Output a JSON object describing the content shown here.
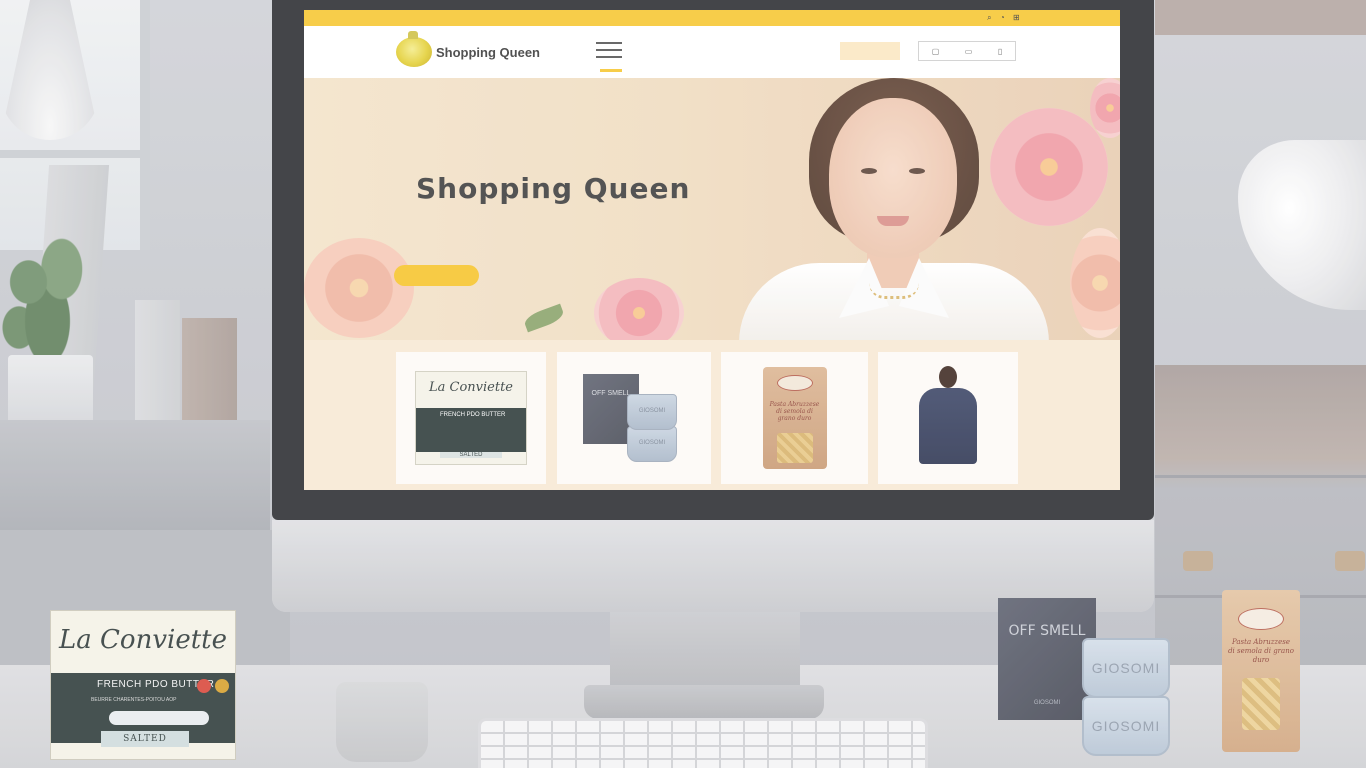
{
  "site": {
    "brand": "Shopping Queen",
    "top_strip_text": "",
    "nav_links": [
      "",
      "",
      ""
    ],
    "nav_button_label": "",
    "nav_sub_text": "",
    "nav_sub_right": ""
  },
  "hero": {
    "title": "Shopping Queen",
    "cta_label": ""
  },
  "product_cards": [
    {
      "name": "la-conviette-butter",
      "brand": "La Conviette",
      "label": "FRENCH PDO BUTTER",
      "variant": "SALTED"
    },
    {
      "name": "off-smell-cups",
      "box_text": "OFF SMELL",
      "cup_text": "GIOSOMI"
    },
    {
      "name": "pasta-bag",
      "text": "Pasta Abruzzese di semola di grano duro"
    },
    {
      "name": "cardigan-model",
      "text": ""
    }
  ],
  "desk_products": {
    "butter": {
      "brand": "La Conviette",
      "title": "FRENCH PDO BUTTER",
      "subtitle": "BEURRE CHARENTES-POITOU AOP",
      "variant": "SALTED"
    },
    "box": {
      "title": "OFF SMELL",
      "bottom": "GIOSOMI"
    },
    "cup_top": "GIOSOMI",
    "cup_bottom": "GIOSOMI",
    "pasta": {
      "text": "Pasta Abruzzese di semola di grano duro"
    }
  },
  "colors": {
    "accent_yellow": "#f6c631",
    "hero_bg": "#f3e3c9",
    "text_dark": "#3d3d3d"
  },
  "icons": [
    "logo-pear-icon",
    "hamburger-menu-icon",
    "search-icon",
    "user-icon",
    "cart-icon"
  ]
}
